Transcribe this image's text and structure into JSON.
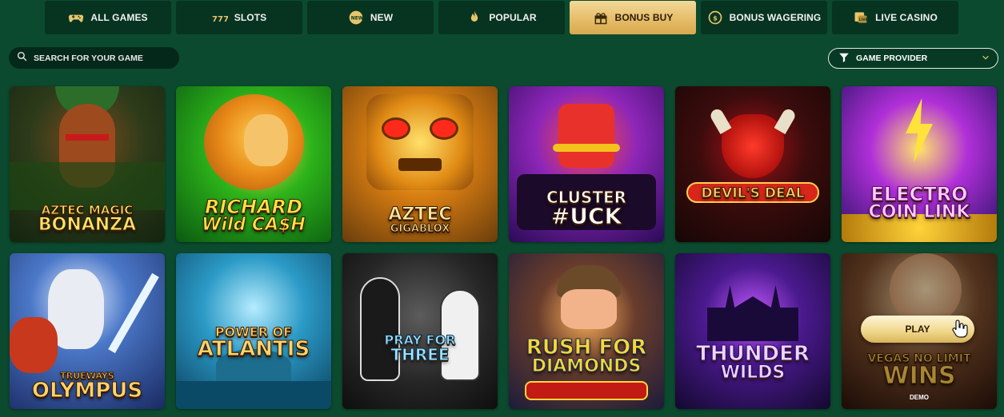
{
  "tabs": [
    {
      "label": "ALL GAMES",
      "icon": "gamepad-icon",
      "active": false
    },
    {
      "label": "SLOTS",
      "icon": "slots-777-icon",
      "active": false
    },
    {
      "label": "NEW",
      "icon": "new-badge-icon",
      "active": false
    },
    {
      "label": "POPULAR",
      "icon": "flame-icon",
      "active": false
    },
    {
      "label": "BONUS BUY",
      "icon": "gift-icon",
      "active": true
    },
    {
      "label": "BONUS WAGERING",
      "icon": "coin-exchange-icon",
      "active": false
    },
    {
      "label": "LIVE CASINO",
      "icon": "live-casino-icon",
      "active": false
    }
  ],
  "search": {
    "placeholder": "SEARCH FOR YOUR GAME"
  },
  "provider": {
    "label": "GAME PROVIDER"
  },
  "games": [
    {
      "title_lines": [
        "AZTEC MAGIC",
        "BONANZA"
      ],
      "title_color": "#ffe36a"
    },
    {
      "title_lines": [
        "RICHARD",
        "Wild CA$H"
      ],
      "title_color": "#ffe14a"
    },
    {
      "title_lines": [
        "AZTEC",
        "GIGABLOX"
      ],
      "title_color": "#ffe7a0"
    },
    {
      "title_lines": [
        "CLUSTER",
        "#UCK"
      ],
      "title_color": "#ffffff"
    },
    {
      "title_lines": [
        "DEVIL'S DEAL"
      ],
      "title_color": "#ffd36a"
    },
    {
      "title_lines": [
        "ELECTRO",
        "COIN LINK"
      ],
      "title_color": "#ffd1ff"
    },
    {
      "title_lines": [
        "TRUEWAYS",
        "OLYMPUS"
      ],
      "title_color": "#ffd36a"
    },
    {
      "title_lines": [
        "POWER OF",
        "ATLANTIS"
      ],
      "title_color": "#ffd36a"
    },
    {
      "title_lines": [
        "PRAY FOR",
        "THREE"
      ],
      "title_color": "#9fe4ff"
    },
    {
      "title_lines": [
        "RUSH FOR",
        "DIAMONDS"
      ],
      "title_color": "#ffd630"
    },
    {
      "title_lines": [
        "THUNDER",
        "WILDS"
      ],
      "title_color": "#e9d8ff"
    },
    {
      "title_lines": [
        "VEGAS NO LIMIT",
        "WINS"
      ],
      "title_color": "#ffce52"
    }
  ],
  "hover_card": {
    "play_label": "PLAY",
    "demo_label": "DEMO"
  }
}
